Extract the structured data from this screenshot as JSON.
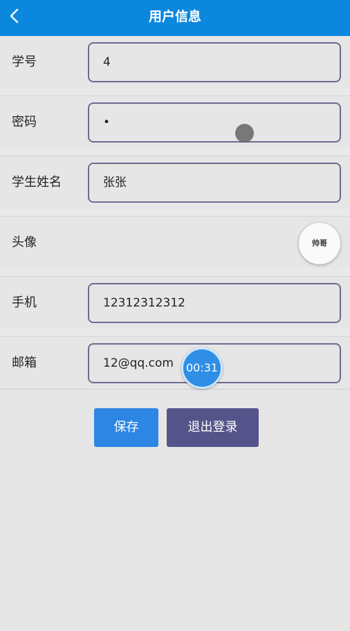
{
  "header": {
    "title": "用户信息",
    "back_icon": "chevron-left-icon"
  },
  "form": {
    "student_id": {
      "label": "学号",
      "value": "4"
    },
    "password": {
      "label": "密码",
      "value": "•"
    },
    "student_name": {
      "label": "学生姓名",
      "value": "张张"
    },
    "avatar": {
      "label": "头像",
      "image_text": "帅哥"
    },
    "phone": {
      "label": "手机",
      "value": "12312312312"
    },
    "email": {
      "label": "邮箱",
      "value": "12@qq.com"
    }
  },
  "overlay": {
    "timer": "00:31"
  },
  "actions": {
    "save_label": "保存",
    "logout_label": "退出登录"
  },
  "colors": {
    "header": "#0b87de",
    "save": "#2e86e4",
    "logout": "#55548a"
  }
}
